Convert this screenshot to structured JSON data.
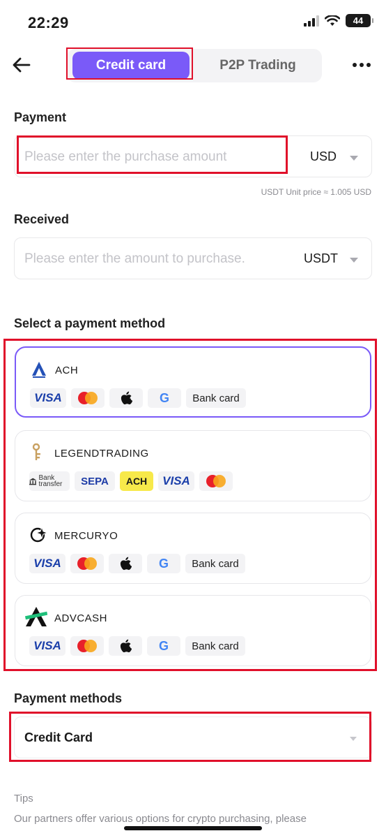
{
  "status_bar": {
    "time": "22:29",
    "battery": "44"
  },
  "nav": {
    "tabs": [
      {
        "label": "Credit card",
        "active": true
      },
      {
        "label": "P2P Trading",
        "active": false
      }
    ]
  },
  "payment": {
    "label": "Payment",
    "placeholder": "Please enter the purchase amount",
    "currency": "USD",
    "unit_price": "USDT Unit price ≈ 1.005 USD"
  },
  "received": {
    "label": "Received",
    "placeholder": "Please enter the amount to purchase.",
    "currency": "USDT"
  },
  "select_method": {
    "label": "Select a payment method",
    "providers": [
      {
        "name": "ACH",
        "selected": true,
        "chips": [
          "VISA",
          "mastercard",
          "apple",
          "google",
          "Bank card"
        ]
      },
      {
        "name": "LEGENDTRADING",
        "selected": false,
        "chips": [
          "Bank transfer",
          "SEPA",
          "ACH",
          "VISA",
          "mastercard"
        ]
      },
      {
        "name": "MERCURYO",
        "selected": false,
        "chips": [
          "VISA",
          "mastercard",
          "apple",
          "google",
          "Bank card"
        ]
      },
      {
        "name": "ADVCASH",
        "selected": false,
        "chips": [
          "VISA",
          "mastercard",
          "apple",
          "google",
          "Bank card"
        ]
      }
    ]
  },
  "payment_methods": {
    "label": "Payment methods",
    "value": "Credit Card"
  },
  "tips": {
    "title": "Tips",
    "text": "Our partners offer various options for crypto purchasing, please"
  },
  "colors": {
    "accent": "#7a5af8",
    "highlight": "#e0102a"
  }
}
